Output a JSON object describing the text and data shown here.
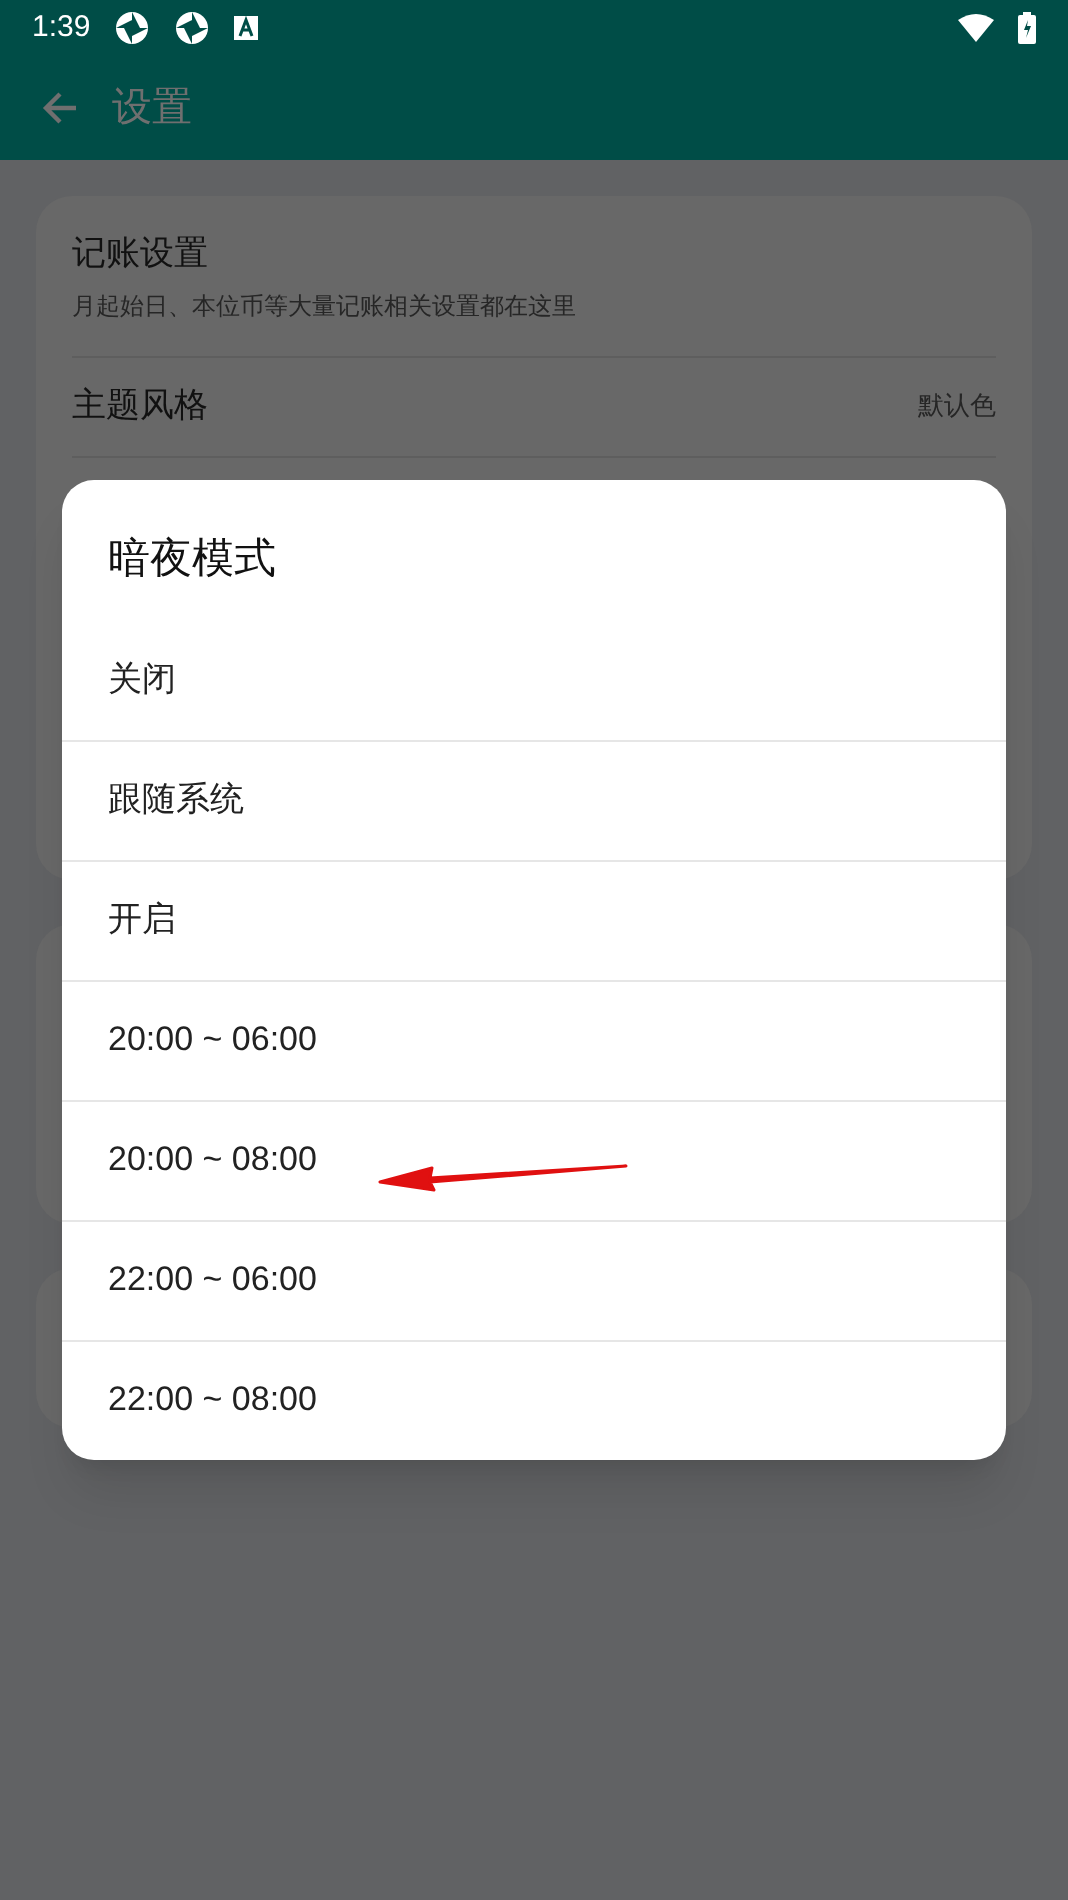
{
  "status_bar": {
    "time": "1:39"
  },
  "app_bar": {
    "title": "设置"
  },
  "settings_card": {
    "title": "记账设置",
    "subtitle": "月起始日、本位币等大量记账相关设置都在这里",
    "rows": [
      {
        "label": "主题风格",
        "value": "默认色"
      }
    ]
  },
  "dialog": {
    "title": "暗夜模式",
    "options": [
      {
        "label": "关闭"
      },
      {
        "label": "跟随系统"
      },
      {
        "label": "开启"
      },
      {
        "label": "20:00 ~ 06:00"
      },
      {
        "label": "20:00 ~ 08:00"
      },
      {
        "label": "22:00 ~ 06:00"
      },
      {
        "label": "22:00 ~ 08:00"
      }
    ]
  }
}
